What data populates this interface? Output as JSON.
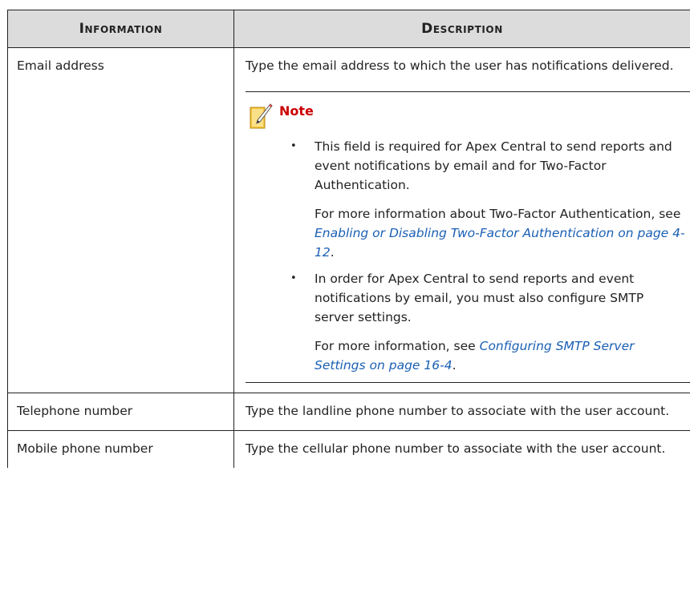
{
  "table": {
    "headers": [
      "Information",
      "Description"
    ],
    "rows": [
      {
        "info": "Email address",
        "description": "Type the email address to which the user has notifications delivered.",
        "note": {
          "title": "Note",
          "items": [
            {
              "p1": "This field is required for Apex Central to send reports and event notifications by email and for Two-Factor Authentication.",
              "p2_prefix": "For more information about Two-Factor Authentication, see ",
              "p2_link": "Enabling or Disabling Two-Factor Authentication on page 4-12",
              "p2_suffix": "."
            },
            {
              "p1": "In order for Apex Central to send reports and event notifications by email, you must also configure SMTP server settings.",
              "p2_prefix": "For more information, see ",
              "p2_link": "Configuring SMTP Server Settings on page 16-4",
              "p2_suffix": "."
            }
          ]
        }
      },
      {
        "info": "Telephone number",
        "description": "Type the landline phone number to associate with the user account."
      },
      {
        "info": "Mobile phone number",
        "description": "Type the cellular phone number to associate with the user account."
      }
    ]
  },
  "icons": {
    "note": "note-pencil-icon",
    "bullet": "bullet-dot"
  },
  "colors": {
    "header_bg": "#dcdcdc",
    "note_title": "#cc0000",
    "link": "#1a5fb4"
  }
}
